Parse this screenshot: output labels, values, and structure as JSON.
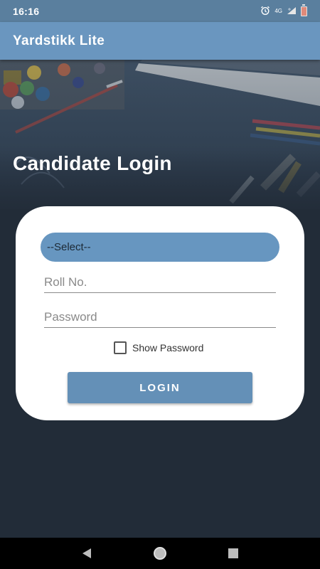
{
  "status_bar": {
    "time": "16:16",
    "network_label": "4G",
    "battery_level_label": "7"
  },
  "app_bar": {
    "title": "Yardstikk Lite"
  },
  "hero": {
    "title": "Candidate Login"
  },
  "login_form": {
    "select_value": "--Select--",
    "roll_placeholder": "Roll No.",
    "roll_value": "",
    "password_placeholder": "Password",
    "password_value": "",
    "show_password_label": "Show Password",
    "show_password_checked": false,
    "login_button_label": "LOGIN"
  },
  "nav_bar": {
    "back_icon": "back-triangle-icon",
    "home_icon": "home-circle-icon",
    "recents_icon": "recents-square-icon"
  },
  "colors": {
    "status_bar": "#5a7f9e",
    "app_bar": "#6a96bf",
    "accent": "#6796c0",
    "button": "#6490b7",
    "background": "#222c38"
  }
}
